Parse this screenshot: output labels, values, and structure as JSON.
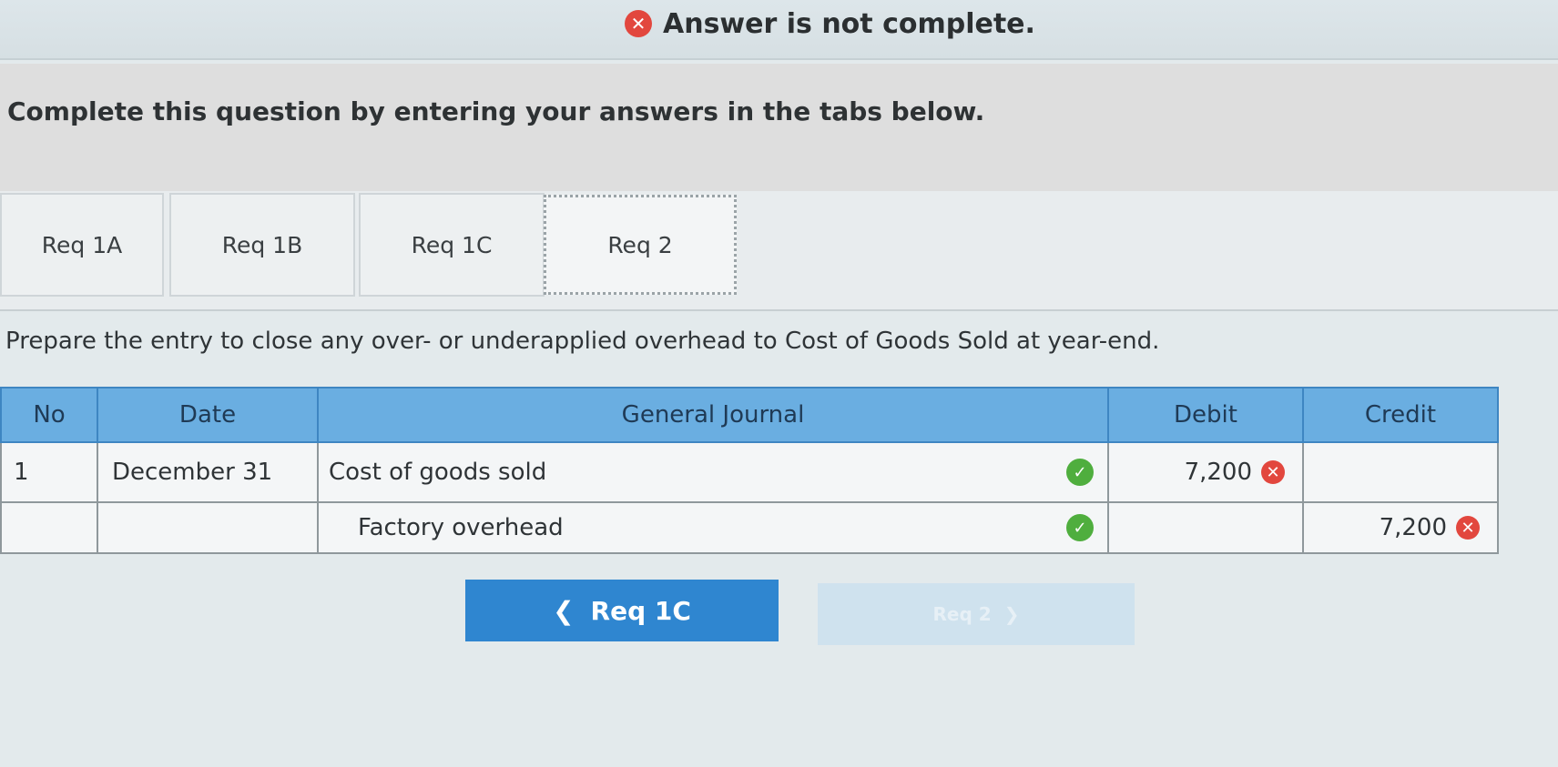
{
  "status": {
    "icon": "error-icon",
    "message": "Answer is not complete."
  },
  "instructions": "Complete this question by entering your answers in the tabs below.",
  "tabs": [
    {
      "label": "Req 1A",
      "active": false
    },
    {
      "label": "Req 1B",
      "active": false
    },
    {
      "label": "Req 1C",
      "active": false
    },
    {
      "label": "Req 2",
      "active": true
    }
  ],
  "prompt": "Prepare the entry to close any over- or underapplied overhead to Cost of Goods Sold at year-end.",
  "journal": {
    "headers": {
      "no": "No",
      "date": "Date",
      "general_journal": "General Journal",
      "debit": "Debit",
      "credit": "Credit"
    },
    "rows": [
      {
        "no": "1",
        "date": "December 31",
        "account": "Cost of goods sold",
        "account_status": "correct",
        "debit": "7,200",
        "debit_status": "incorrect",
        "credit": ""
      },
      {
        "no": "",
        "date": "",
        "account": "Factory overhead",
        "account_status": "correct",
        "debit": "",
        "credit": "7,200",
        "credit_status": "incorrect"
      }
    ]
  },
  "navigation": {
    "prev": {
      "label": "Req 1C",
      "icon": "chevron-left-icon"
    },
    "next": {
      "label": "Req 2",
      "icon": "chevron-right-icon",
      "disabled": true
    }
  },
  "colors": {
    "accent": "#2f86d0",
    "header": "#6aaee1",
    "error": "#e2473e",
    "success": "#4fae3e"
  }
}
